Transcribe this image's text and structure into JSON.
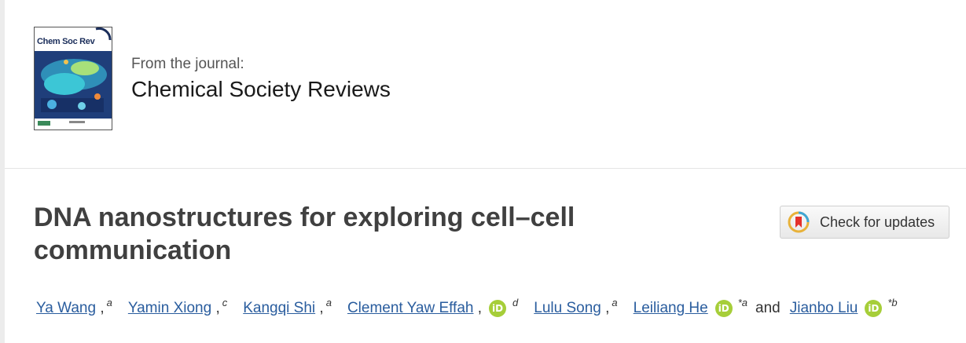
{
  "journal": {
    "cover_title": "Chem Soc Rev",
    "from_label": "From the journal:",
    "name": "Chemical Society Reviews"
  },
  "article": {
    "title": "DNA nanostructures for exploring cell–cell communication"
  },
  "check_updates": {
    "label": "Check for updates",
    "icon": "crossmark-icon"
  },
  "authors": [
    {
      "name": "Ya Wang",
      "aff": "a",
      "orcid": false
    },
    {
      "name": "Yamin Xiong",
      "aff": "c",
      "orcid": false
    },
    {
      "name": "Kangqi Shi",
      "aff": "a",
      "orcid": false
    },
    {
      "name": "Clement Yaw Effah",
      "aff": "d",
      "orcid": true
    },
    {
      "name": "Lulu Song",
      "aff": "a",
      "orcid": false
    },
    {
      "name": "Leiliang He",
      "aff": "*a",
      "orcid": true
    },
    {
      "name": "Jianbo Liu",
      "aff": "*b",
      "orcid": true
    }
  ],
  "authors_and": "and",
  "orcid_text": "iD",
  "colors": {
    "link": "#2a5d9e",
    "orcid": "#a6ce39",
    "title": "#404040"
  }
}
